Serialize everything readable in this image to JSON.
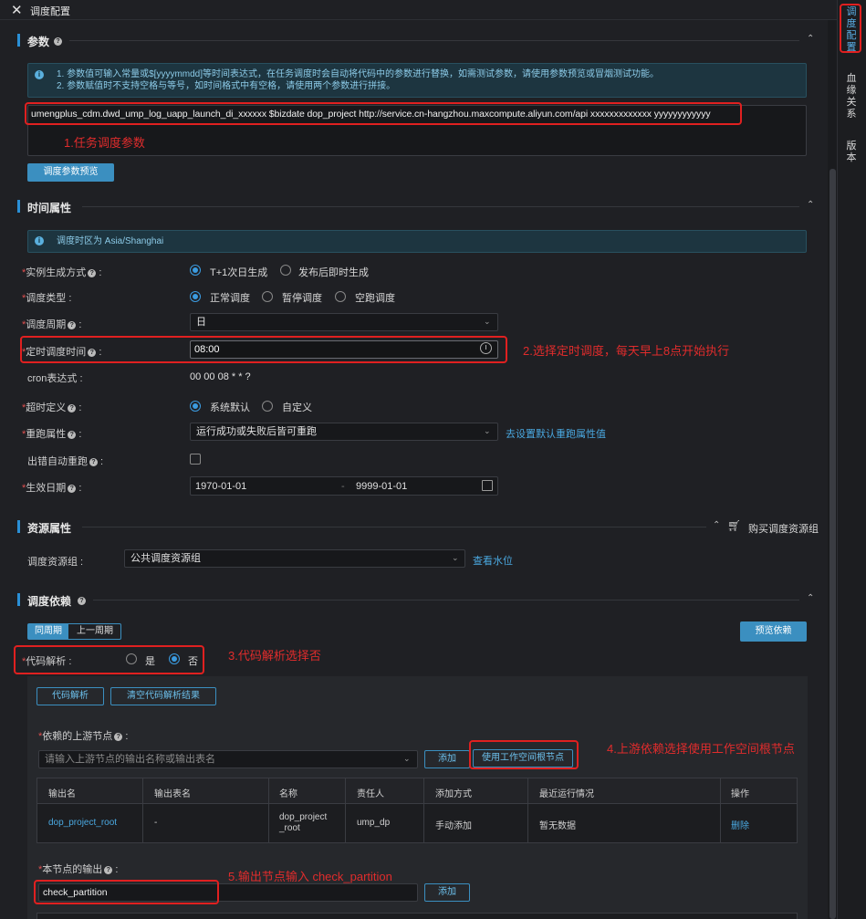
{
  "header": {
    "title": "调度配置",
    "close_icon": "close-icon"
  },
  "right_tabs": [
    {
      "label": "调度配置",
      "active": true
    },
    {
      "label": "血缘关系",
      "active": false
    },
    {
      "label": "版本",
      "active": false
    }
  ],
  "params": {
    "title": "参数",
    "info_line1": "1. 参数值可输入常量或$[yyyymmdd]等时间表达式，在任务调度时会自动将代码中的参数进行替换，如需测试参数，请使用参数预览或冒烟测试功能。",
    "info_line2": "2. 参数赋值时不支持空格与等号，如时间格式中有空格，请使用两个参数进行拼接。",
    "value": "umengplus_cdm.dwd_ump_log_uapp_launch_di_xxxxxx $bizdate dop_project http://service.cn-hangzhou.maxcompute.aliyun.com/api xxxxxxxxxxxxx yyyyyyyyyyyy",
    "annotation": "1.任务调度参数",
    "preview_button": "调度参数预览"
  },
  "time": {
    "title": "时间属性",
    "info": "调度时区为 Asia/Shanghai",
    "instance_label": "实例生成方式",
    "instance_options": [
      "T+1次日生成",
      "发布后即时生成"
    ],
    "type_label": "调度类型",
    "type_options": [
      "正常调度",
      "暂停调度",
      "空跑调度"
    ],
    "cycle_label": "调度周期",
    "cycle_value": "日",
    "timed_label": "定时调度时间",
    "timed_value": "08:00",
    "annotation": "2.选择定时调度，每天早上8点开始执行",
    "cron_label": "cron表达式",
    "cron_value": "00 00 08 * * ?",
    "timeout_label": "超时定义",
    "timeout_options": [
      "系统默认",
      "自定义"
    ],
    "rerun_label": "重跑属性",
    "rerun_value": "运行成功或失败后皆可重跑",
    "rerun_link": "去设置默认重跑属性值",
    "auto_rerun_label": "出错自动重跑",
    "effective_label": "生效日期",
    "effective_start": "1970-01-01",
    "effective_sep": "-",
    "effective_end": "9999-01-01"
  },
  "resource": {
    "title": "资源属性",
    "buy_link": "购买调度资源组",
    "group_label": "调度资源组",
    "group_value": "公共调度资源组",
    "watermark_link": "查看水位"
  },
  "deps": {
    "title": "调度依赖",
    "seg_options": [
      "同周期",
      "上一周期"
    ],
    "preview_button": "预览依赖",
    "parse_label": "代码解析",
    "parse_options": [
      "是",
      "否"
    ],
    "annotation3": "3.代码解析选择否",
    "parse_button": "代码解析",
    "clear_button": "清空代码解析结果",
    "upstream_label": "依赖的上游节点",
    "upstream_placeholder": "请输入上游节点的输出名称或输出表名",
    "add_button": "添加",
    "root_button": "使用工作空间根节点",
    "annotation4": "4.上游依赖选择使用工作空间根节点",
    "columns": [
      "输出名",
      "输出表名",
      "名称",
      "责任人",
      "添加方式",
      "最近运行情况",
      "操作"
    ],
    "row": {
      "output_name": "dop_project_root",
      "table_name": "-",
      "name": "dop_project_root",
      "owner": "ump_dp",
      "add_method": "手动添加",
      "last_run": "暂无数据",
      "action": "删除"
    },
    "output_label": "本节点的输出",
    "annotation5": "5.输出节点输入 check_partition",
    "output_value": "check_partition",
    "output_add_button": "添加"
  },
  "colors": {
    "accent": "#3b8fc0",
    "annotation": "#e02020"
  }
}
